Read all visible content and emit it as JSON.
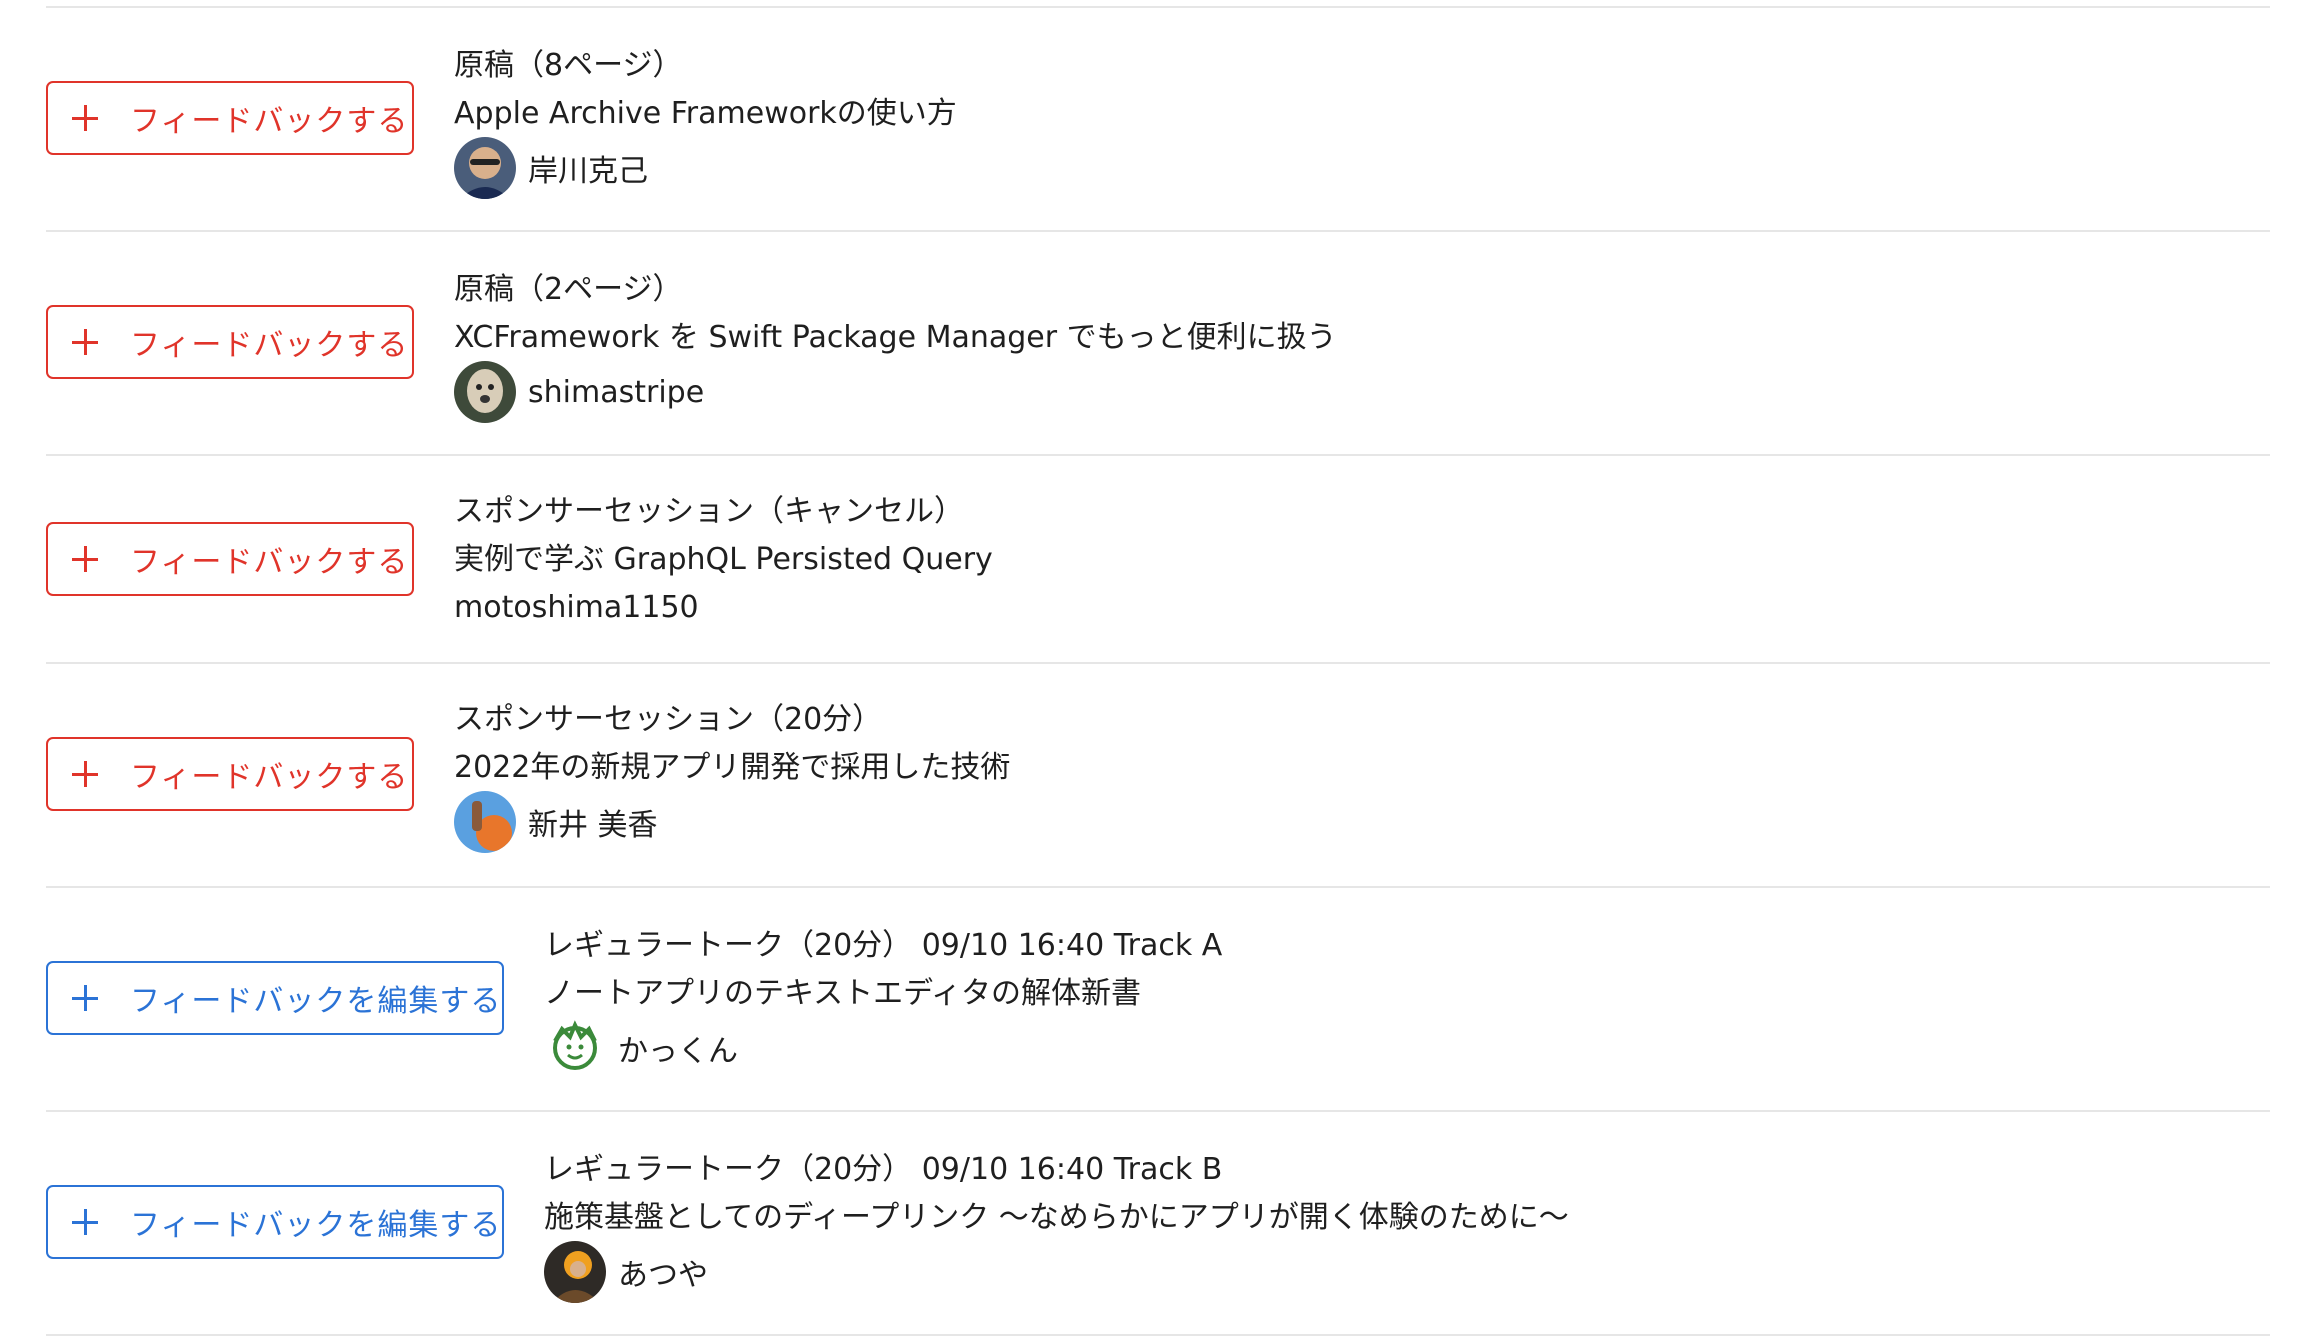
{
  "feedback_add_label": "フィードバックする",
  "feedback_edit_label": "フィードバックを編集する",
  "sessions": [
    {
      "category": "原稿（8ページ）",
      "title": "Apple Archive Frameworkの使い方",
      "speaker": "岸川克己",
      "avatar_icon": "avatar-photo",
      "mode": "add"
    },
    {
      "category": "原稿（2ページ）",
      "title": "XCFramework を Swift Package Manager でもっと便利に扱う",
      "speaker": "shimastripe",
      "avatar_icon": "avatar-photo",
      "mode": "add"
    },
    {
      "category": "スポンサーセッション（キャンセル）",
      "title": "実例で学ぶ GraphQL Persisted Query",
      "speaker": "motoshima1150",
      "avatar_icon": "",
      "mode": "add"
    },
    {
      "category": "スポンサーセッション（20分）",
      "title": "2022年の新規アプリ開発で採用した技術",
      "speaker": "新井 美香",
      "avatar_icon": "avatar-photo",
      "mode": "add"
    },
    {
      "category": "レギュラートーク（20分） 09/10 16:40 Track A",
      "title": "ノートアプリのテキストエディタの解体新書",
      "speaker": "かっくん",
      "avatar_icon": "avatar-illustration",
      "mode": "edit"
    },
    {
      "category": "レギュラートーク（20分） 09/10 16:40 Track B",
      "title": "施策基盤としてのディープリンク 〜なめらかにアプリが開く体験のために〜",
      "speaker": "あつや",
      "avatar_icon": "avatar-photo",
      "mode": "edit"
    }
  ],
  "colors": {
    "add_accent": "#e0342a",
    "edit_accent": "#2b73d6",
    "divider": "#e6e6e6"
  }
}
